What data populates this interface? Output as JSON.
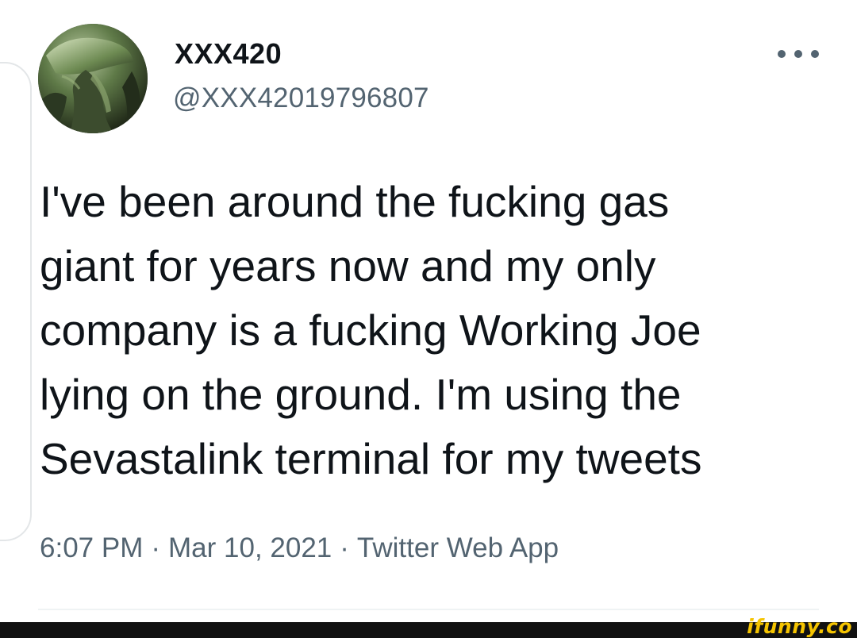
{
  "tweet": {
    "display_name": "XXX420",
    "handle": "@XXX42019796807",
    "text_lines": [
      "I've been around the fucking gas",
      "giant for years now and my only",
      "company is a fucking Working Joe",
      "lying on the ground. I'm using the",
      "Sevastalink terminal for my tweets"
    ],
    "time": "6:07 PM",
    "separator": "·",
    "date": "Mar 10, 2021",
    "source": "Twitter Web App"
  },
  "icons": {
    "more": "more-horizontal-icon",
    "avatar": "alien-avatar"
  },
  "watermark": {
    "text": "ifunny.co"
  },
  "colors": {
    "text_primary": "#0f1419",
    "text_secondary": "#536471",
    "divider": "#eff3f4",
    "watermark": "#f5c400",
    "footer": "#111111"
  }
}
